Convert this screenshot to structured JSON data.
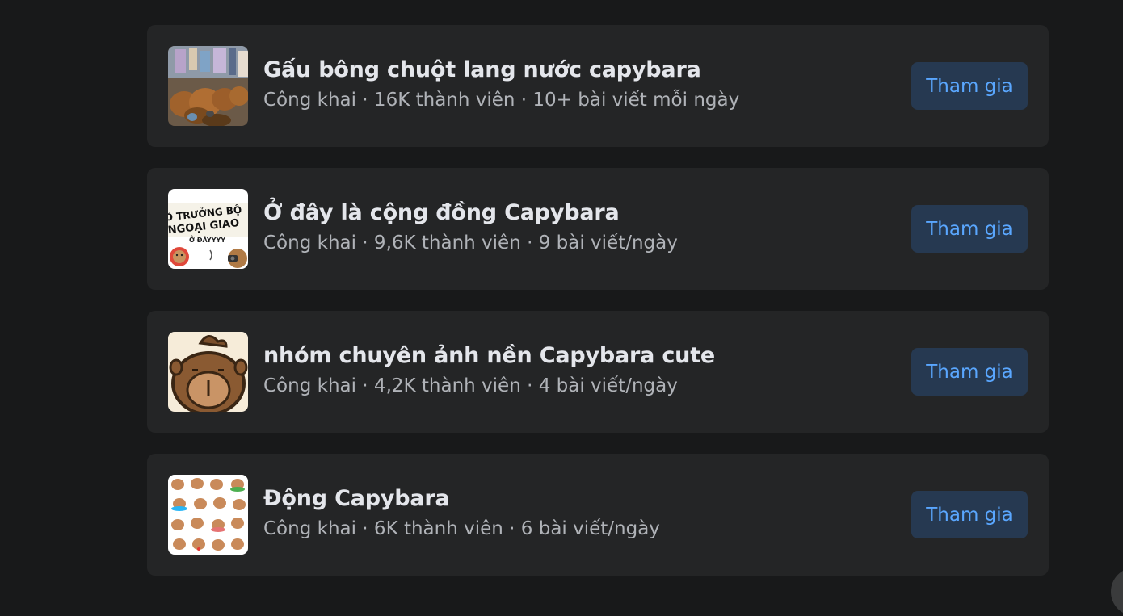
{
  "groups": [
    {
      "thumbnail_icon": "capybara-plush-photo",
      "name": "Gấu bông chuột lang nước capybara",
      "meta": "Công khai · 16K thành viên · 10+ bài viết mỗi ngày",
      "join_label": "Tham gia"
    },
    {
      "thumbnail_icon": "capybara-sticker-thumbnail",
      "thumbnail_text_line1": "Ô TRƯỞNG BỘ",
      "thumbnail_text_line2": "NGOẠI GIAO",
      "thumbnail_text_line3": "Ở ĐÂYYYY",
      "name": "Ở đây là cộng đồng Capybara",
      "meta": "Công khai · 9,6K thành viên · 9 bài viết/ngày",
      "join_label": "Tham gia"
    },
    {
      "thumbnail_icon": "capybara-face-cartoon",
      "name": "nhóm chuyên ảnh nền Capybara cute",
      "meta": "Công khai · 4,2K thành viên · 4 bài viết/ngày",
      "join_label": "Tham gia"
    },
    {
      "thumbnail_icon": "capybara-sticker-grid",
      "name": "Động Capybara",
      "meta": "Công khai · 6K thành viên · 6 bài viết/ngày",
      "join_label": "Tham gia"
    }
  ]
}
